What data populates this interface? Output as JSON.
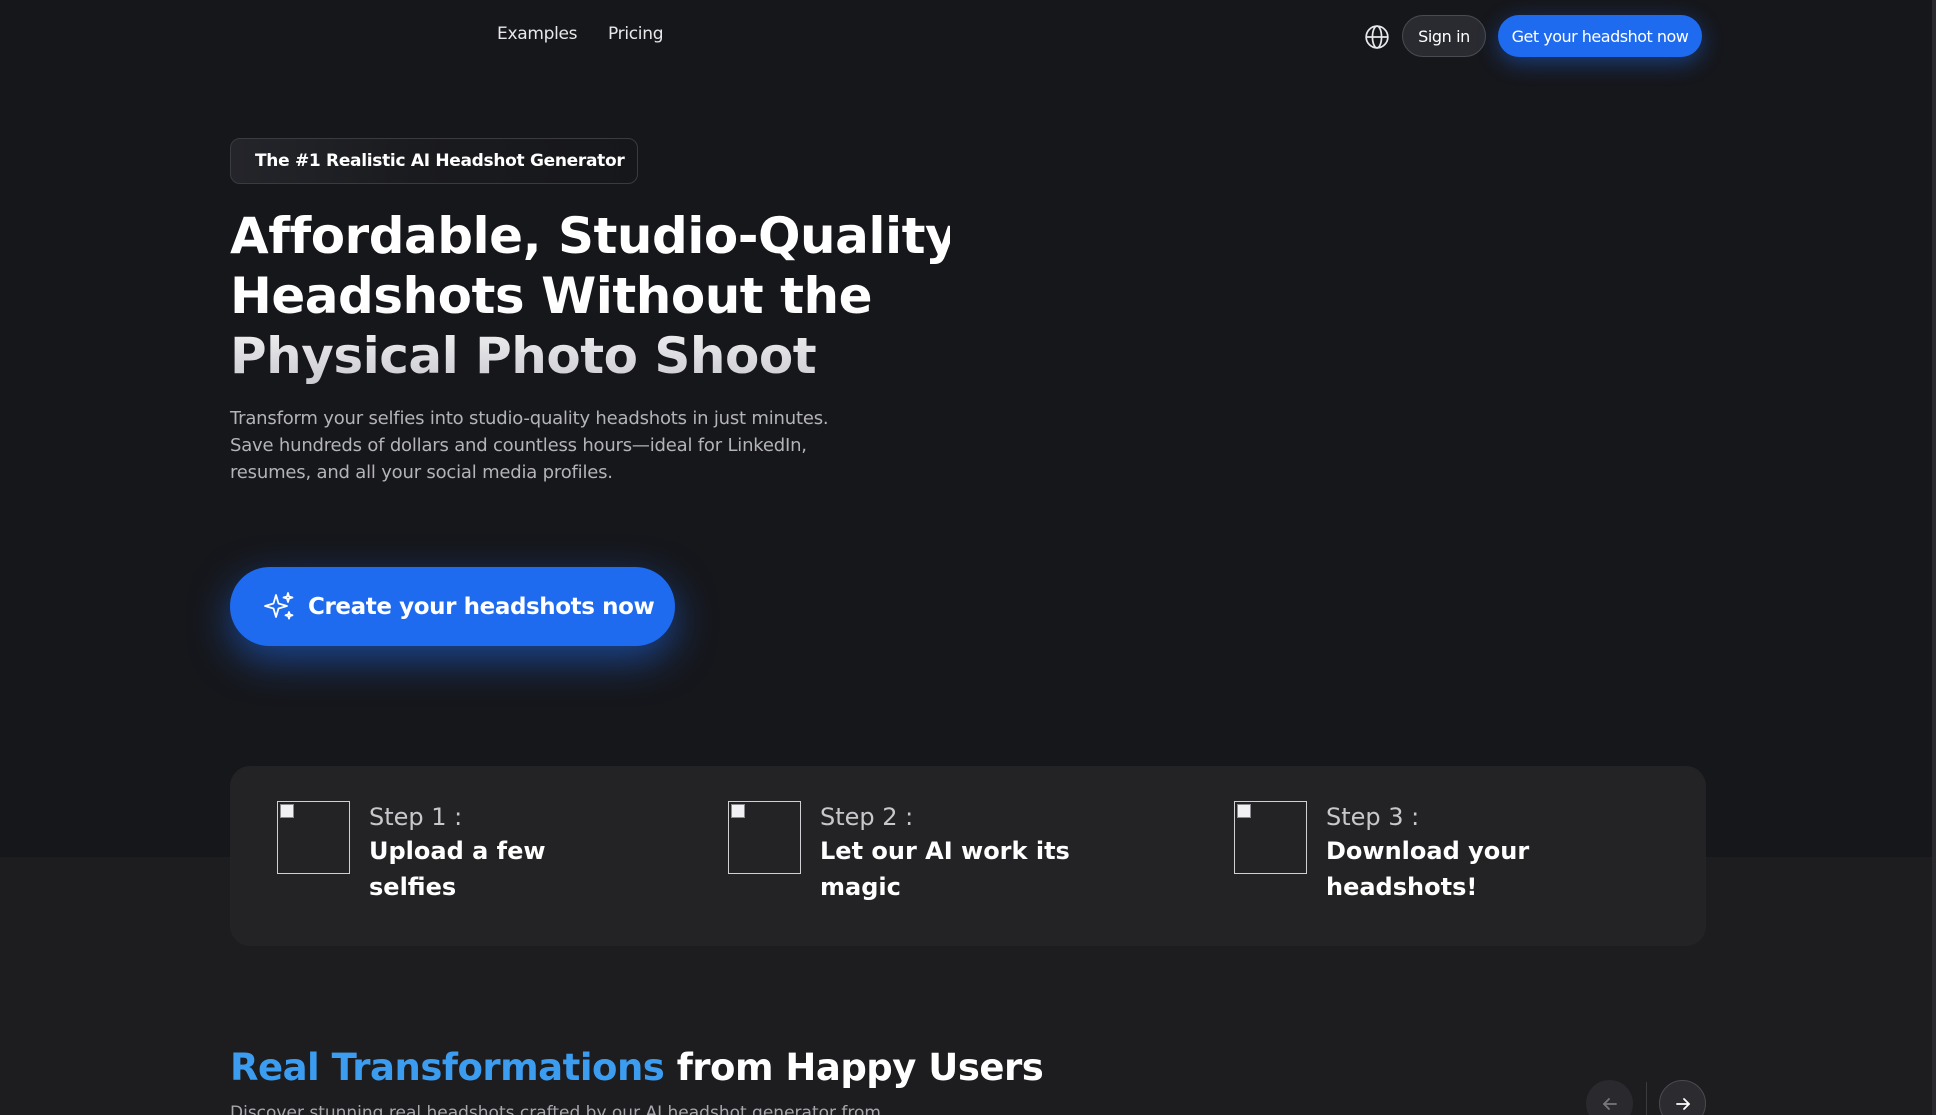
{
  "nav": {
    "links": [
      {
        "label": "Examples"
      },
      {
        "label": "Pricing"
      }
    ],
    "globe_icon": "globe-icon",
    "signin_label": "Sign in",
    "cta_label": "Get your headshot now",
    "cta_color": "#1f6bf0"
  },
  "hero": {
    "tag": "The #1 Realistic AI Headshot Generator",
    "title_lines": [
      "Affordable, Studio-Quality",
      "Headshots Without the",
      "Physical Photo Shoot"
    ],
    "subtitle_lines": [
      "Transform your selfies into studio-quality headshots in just minutes.",
      "Save hundreds of dollars and countless hours—ideal for LinkedIn,",
      "resumes, and all your social media profiles."
    ],
    "cta_label": "Create your headshots now",
    "cta_icon": "sparkle-icon"
  },
  "steps": [
    {
      "label": "Step 1 :",
      "desc_lines": [
        "Upload a few",
        "selfies"
      ]
    },
    {
      "label": "Step 2 :",
      "desc_lines": [
        "Let our AI work its",
        "magic"
      ]
    },
    {
      "label": "Step 3 :",
      "desc_lines": [
        "Download your",
        "headshots!"
      ]
    }
  ],
  "transformations": {
    "title_accent": "Real Transformations",
    "title_rest": " from Happy Users",
    "accent_color": "#3c9cf0",
    "subtitle": "Discover stunning real headshots crafted by our AI headshot generator from",
    "prev_icon": "arrow-left-icon",
    "next_icon": "arrow-right-icon"
  }
}
